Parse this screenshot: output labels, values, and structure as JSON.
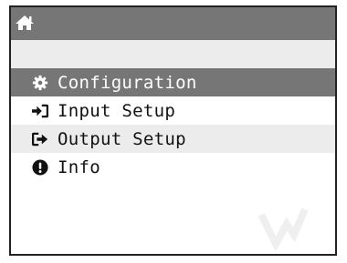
{
  "header": {
    "icon": "home-icon"
  },
  "menu": {
    "items": [
      {
        "label": "Configuration",
        "icon": "gear-icon",
        "selected": true
      },
      {
        "label": "Input Setup",
        "icon": "sign-in-icon",
        "selected": false
      },
      {
        "label": "Output Setup",
        "icon": "sign-out-icon",
        "selected": false
      },
      {
        "label": "Info",
        "icon": "exclamation-circle-icon",
        "selected": false
      }
    ]
  },
  "colors": {
    "titlebar": "#767676",
    "selected_background": "#767676",
    "alternate_row": "#ececec",
    "text": "#111111",
    "selected_text": "#ffffff"
  }
}
